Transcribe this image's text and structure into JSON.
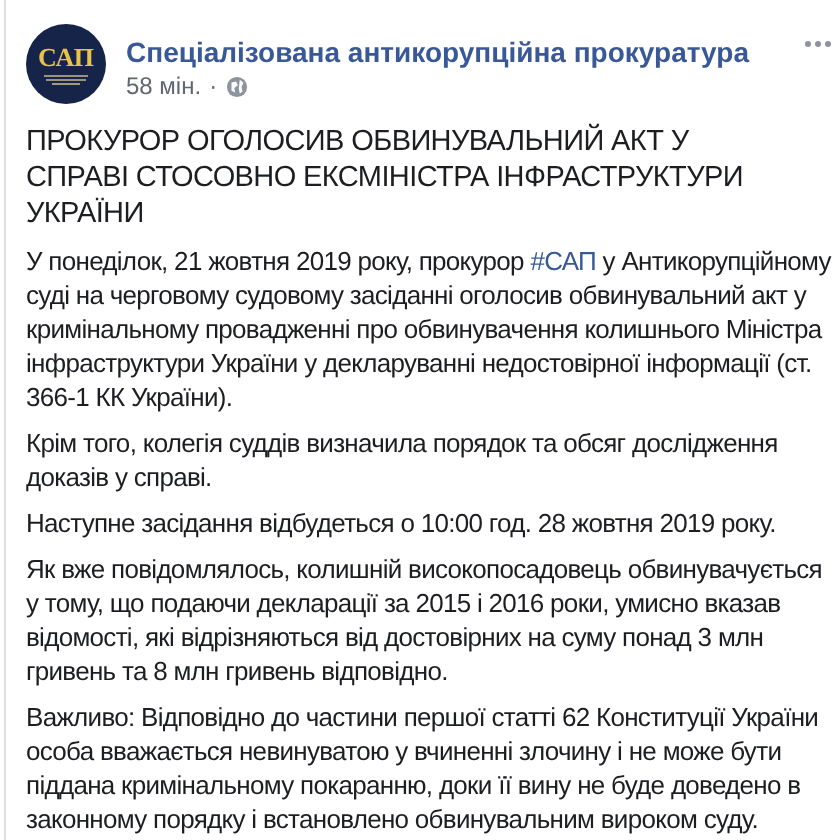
{
  "post": {
    "logo": {
      "text": "САП"
    },
    "author": "Спеціалізована антикорупційна прокуратура",
    "time": "58 мін.",
    "separator": "·",
    "title": "ПРОКУРОР ОГОЛОСИВ ОБВИНУВАЛЬНИЙ АКТ У СПРАВІ СТОСОВНО ЕКСМІНІСТРА ІНФРАСТРУКТУРИ УКРАЇНИ",
    "paragraphs": [
      {
        "parts": [
          {
            "kind": "text",
            "text": "У понеділок, 21 жовтня 2019 року, прокурор "
          },
          {
            "kind": "hashtag",
            "text": "#САП"
          },
          {
            "kind": "text",
            "text": " у Антикорупційному суді на черговому судовому засіданні оголосив обвинувальний акт у кримінальному провадженні про обвинувачення колишнього Міністра інфраструктури України у декларуванні недостовірної інформації (ст. 366-1 КК України)."
          }
        ]
      },
      {
        "parts": [
          {
            "kind": "text",
            "text": "Крім того, колегія суддів визначила порядок та обсяг дослідження доказів у справі."
          }
        ]
      },
      {
        "parts": [
          {
            "kind": "text",
            "text": "Наступне засідання відбудеться о 10:00 год. 28 жовтня 2019 року."
          }
        ]
      },
      {
        "parts": [
          {
            "kind": "text",
            "text": "Як вже повідомлялось, колишній високопосадовець обвинувачується у тому, що подаючи декларації за 2015 і 2016 роки, умисно вказав відомості, які відрізняються від достовірних на суму понад 3 млн гривень та 8 млн гривень відповідно."
          }
        ]
      },
      {
        "parts": [
          {
            "kind": "text",
            "text": "Важливо: Відповідно до частини першої статті 62 Конституції України особа вважається невинуватою у вчиненні злочину і не може бути піддана кримінальному покаранню, доки її вину не буде доведено в законному порядку і встановлено обвинувальним вироком суду."
          }
        ]
      }
    ]
  }
}
